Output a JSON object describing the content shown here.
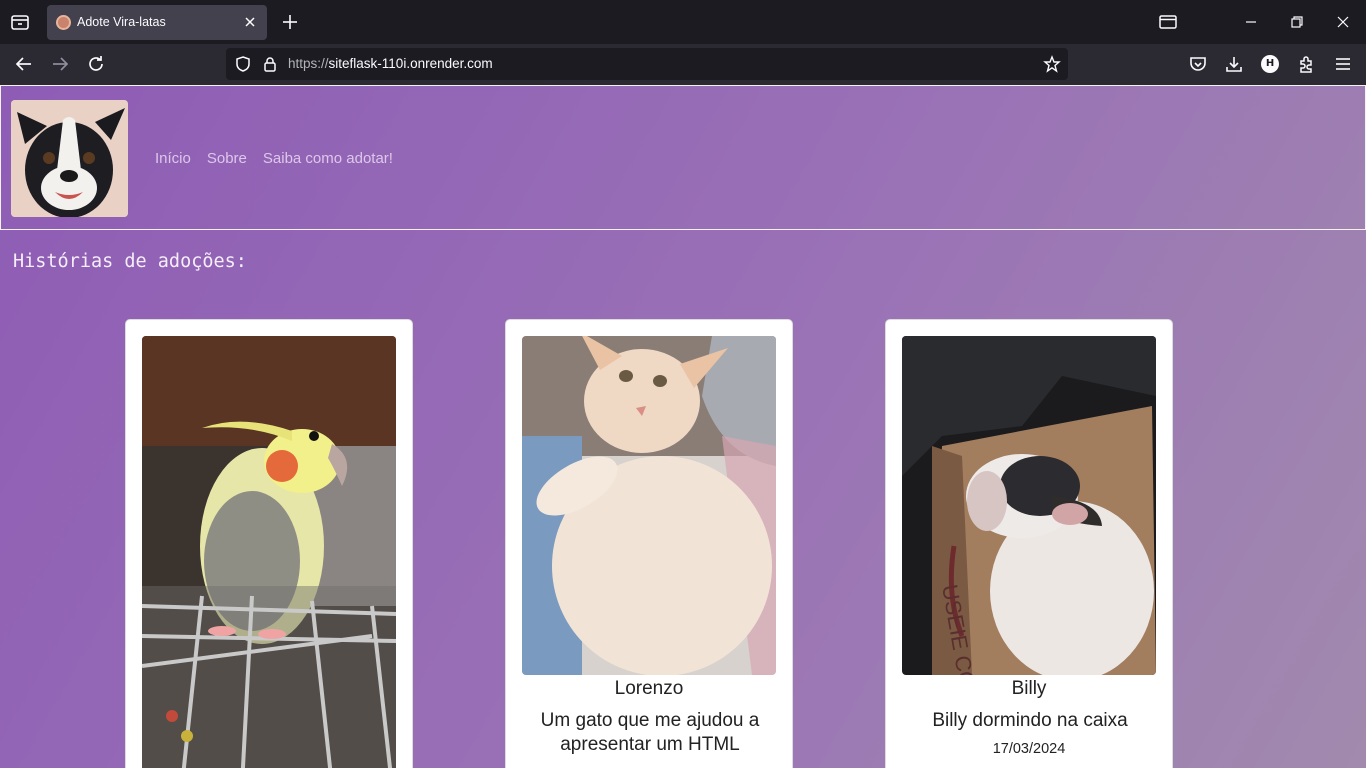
{
  "browser": {
    "tab_title": "Adote Vira-latas",
    "url_protocol": "https://",
    "url_host": "siteflask-110i.onrender.com",
    "account_initial": "H"
  },
  "site": {
    "nav": [
      "Início",
      "Sobre",
      "Saiba como adotar!"
    ],
    "section_title": "Histórias de adoções:"
  },
  "cards": [
    {
      "name": "",
      "description": "",
      "date": ""
    },
    {
      "name": "Lorenzo",
      "description": "Um gato que me ajudou a apresentar um HTML",
      "date": ""
    },
    {
      "name": "Billy",
      "description": "Billy dormindo na caixa",
      "date": "17/03/2024"
    }
  ]
}
